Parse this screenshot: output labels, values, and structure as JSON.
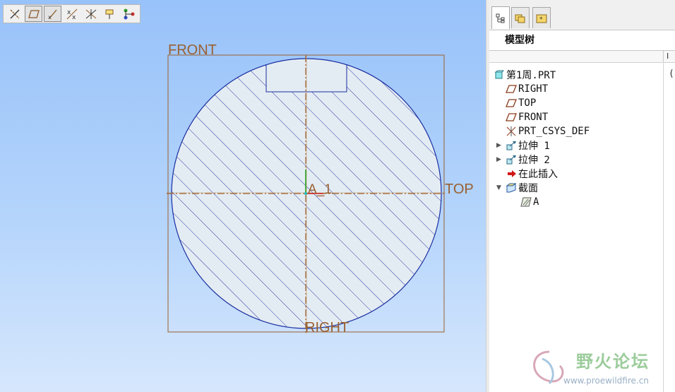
{
  "toolbar": {
    "buttons": [
      {
        "name": "datum-axes-display-icon",
        "active": false
      },
      {
        "name": "datum-planes-display-icon",
        "active": true
      },
      {
        "name": "datum-points-display-icon",
        "active": true
      },
      {
        "name": "point-tags-display-icon",
        "active": false
      },
      {
        "name": "coord-sys-display-icon",
        "active": false
      },
      {
        "name": "annotation-display-icon",
        "active": false
      },
      {
        "name": "spin-center-display-icon",
        "active": false
      }
    ]
  },
  "viewport": {
    "plane_labels": {
      "front": "FRONT",
      "top": "TOP",
      "right": "RIGHT"
    },
    "section_label": "A_1",
    "colors": {
      "hatch": "#2b3aa8",
      "outline": "#1a2ea0",
      "datum": "#9a6030",
      "fill": "#e4ecf3"
    }
  },
  "model_tree": {
    "title": "模型树",
    "column_header": "I",
    "items": [
      {
        "label": "第1周.PRT",
        "icon": "part-icon",
        "extra": "(-",
        "level": 0
      },
      {
        "label": "RIGHT",
        "icon": "datum-plane-icon",
        "level": 1
      },
      {
        "label": "TOP",
        "icon": "datum-plane-icon",
        "level": 1
      },
      {
        "label": "FRONT",
        "icon": "datum-plane-icon",
        "level": 1
      },
      {
        "label": "PRT_CSYS_DEF",
        "icon": "csys-icon",
        "level": 1
      },
      {
        "label": "拉伸 1",
        "icon": "extrude-icon",
        "level": 1,
        "expandable": true
      },
      {
        "label": "拉伸 2",
        "icon": "extrude-icon",
        "level": 1,
        "expandable": true
      },
      {
        "label": "在此插入",
        "icon": "insert-here-icon",
        "level": 1
      },
      {
        "label": "截面",
        "icon": "section-folder-icon",
        "level": 1,
        "expanded": true
      },
      {
        "label": "A",
        "icon": "xsection-icon",
        "level": 2
      }
    ]
  },
  "watermark": {
    "text": "野火论坛",
    "url": "www.proewildfire.cn"
  }
}
